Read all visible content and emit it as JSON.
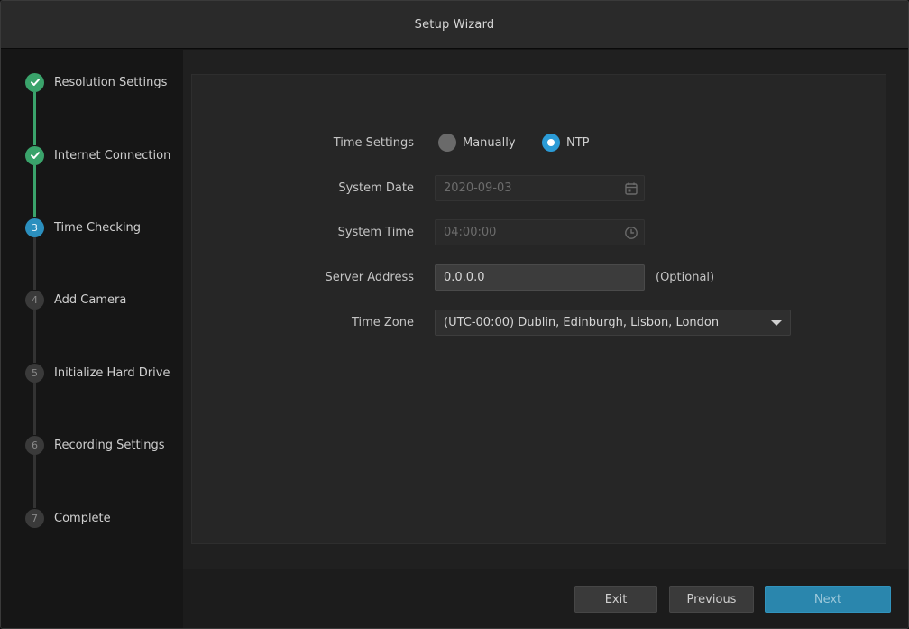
{
  "window": {
    "title": "Setup Wizard"
  },
  "steps": [
    {
      "num": "1",
      "label": "Resolution Settings",
      "state": "done"
    },
    {
      "num": "2",
      "label": "Internet Connection",
      "state": "done"
    },
    {
      "num": "3",
      "label": "Time Checking",
      "state": "active"
    },
    {
      "num": "4",
      "label": "Add Camera",
      "state": "pending"
    },
    {
      "num": "5",
      "label": "Initialize Hard Drive",
      "state": "pending"
    },
    {
      "num": "6",
      "label": "Recording Settings",
      "state": "pending"
    },
    {
      "num": "7",
      "label": "Complete",
      "state": "pending"
    }
  ],
  "form": {
    "time_settings": {
      "label": "Time Settings",
      "options": [
        {
          "label": "Manually",
          "selected": false
        },
        {
          "label": "NTP",
          "selected": true
        }
      ]
    },
    "system_date": {
      "label": "System Date",
      "value": "2020-09-03",
      "icon": "calendar-icon"
    },
    "system_time": {
      "label": "System Time",
      "value": "04:00:00",
      "icon": "clock-icon"
    },
    "server_address": {
      "label": "Server Address",
      "value": "0.0.0.0",
      "hint": "(Optional)"
    },
    "time_zone": {
      "label": "Time Zone",
      "value": "(UTC-00:00) Dublin, Edinburgh, Lisbon, London"
    }
  },
  "footer": {
    "exit_label": "Exit",
    "previous_label": "Previous",
    "next_label": "Next"
  },
  "colors": {
    "done": "#3aa36b",
    "active": "#2b8fbe",
    "radio_on": "#2b9bd6",
    "primary_button": "#2a86ad"
  }
}
